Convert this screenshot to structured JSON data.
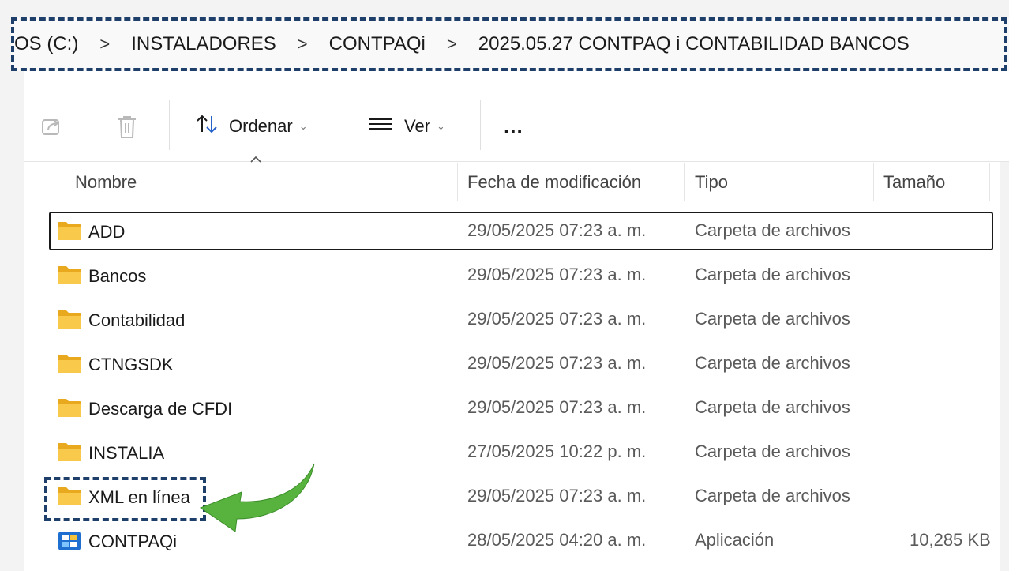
{
  "breadcrumb": {
    "items": [
      "OS (C:)",
      "INSTALADORES",
      "CONTPAQi",
      "2025.05.27 CONTPAQ i CONTABILIDAD BANCOS"
    ],
    "separator": ">"
  },
  "toolbar": {
    "sort_label": "Ordenar",
    "view_label": "Ver",
    "more_label": "..."
  },
  "columns": {
    "name": "Nombre",
    "date": "Fecha de modificación",
    "type": "Tipo",
    "size": "Tamaño"
  },
  "files": [
    {
      "name": "ADD",
      "date": "29/05/2025 07:23 a. m.",
      "type": "Carpeta de archivos",
      "size": "",
      "icon": "folder-icon"
    },
    {
      "name": "Bancos",
      "date": "29/05/2025 07:23 a. m.",
      "type": "Carpeta de archivos",
      "size": "",
      "icon": "folder-icon"
    },
    {
      "name": "Contabilidad",
      "date": "29/05/2025 07:23 a. m.",
      "type": "Carpeta de archivos",
      "size": "",
      "icon": "folder-icon"
    },
    {
      "name": "CTNGSDK",
      "date": "29/05/2025 07:23 a. m.",
      "type": "Carpeta de archivos",
      "size": "",
      "icon": "folder-icon"
    },
    {
      "name": "Descarga de CFDI",
      "date": "29/05/2025 07:23 a. m.",
      "type": "Carpeta de archivos",
      "size": "",
      "icon": "folder-icon"
    },
    {
      "name": "INSTALIA",
      "date": "27/05/2025 10:22 p. m.",
      "type": "Carpeta de archivos",
      "size": "",
      "icon": "folder-icon"
    },
    {
      "name": "XML en línea",
      "date": "29/05/2025 07:23 a. m.",
      "type": "Carpeta de archivos",
      "size": "",
      "icon": "folder-icon"
    },
    {
      "name": "CONTPAQi",
      "date": "28/05/2025 04:20 a. m.",
      "type": "Aplicación",
      "size": "10,285 KB",
      "icon": "app-icon"
    }
  ],
  "colors": {
    "highlight_border": "#1f3f6b",
    "arrow": "#4caf3a",
    "folder": "#f5c23c"
  }
}
